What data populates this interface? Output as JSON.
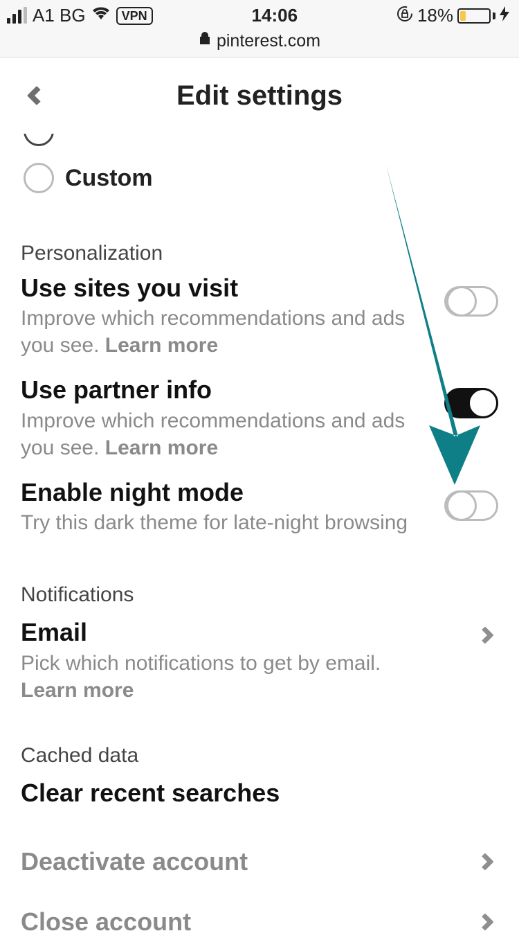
{
  "status_bar": {
    "carrier": "A1 BG",
    "vpn": "VPN",
    "time": "14:06",
    "battery_percent": "18%"
  },
  "browser": {
    "url": "pinterest.com"
  },
  "header": {
    "title": "Edit settings"
  },
  "radio": {
    "custom_label": "Custom"
  },
  "sections": {
    "personalization": {
      "header": "Personalization",
      "use_sites": {
        "title": "Use sites you visit",
        "desc": "Improve which recommendations and ads you see. ",
        "learn": "Learn more"
      },
      "partner_info": {
        "title": "Use partner info",
        "desc": "Improve which recommendations and ads you see. ",
        "learn": "Learn more"
      },
      "night_mode": {
        "title": "Enable night mode",
        "desc": "Try this dark theme for late-night browsing"
      }
    },
    "notifications": {
      "header": "Notifications",
      "email": {
        "title": "Email",
        "desc": "Pick which notifications to get by email. ",
        "learn": "Learn more"
      }
    },
    "cached": {
      "header": "Cached data",
      "clear_searches": "Clear recent searches"
    },
    "account": {
      "deactivate": "Deactivate account",
      "close": "Close account"
    }
  },
  "annotation": {
    "arrow_color": "#0e7f87"
  }
}
